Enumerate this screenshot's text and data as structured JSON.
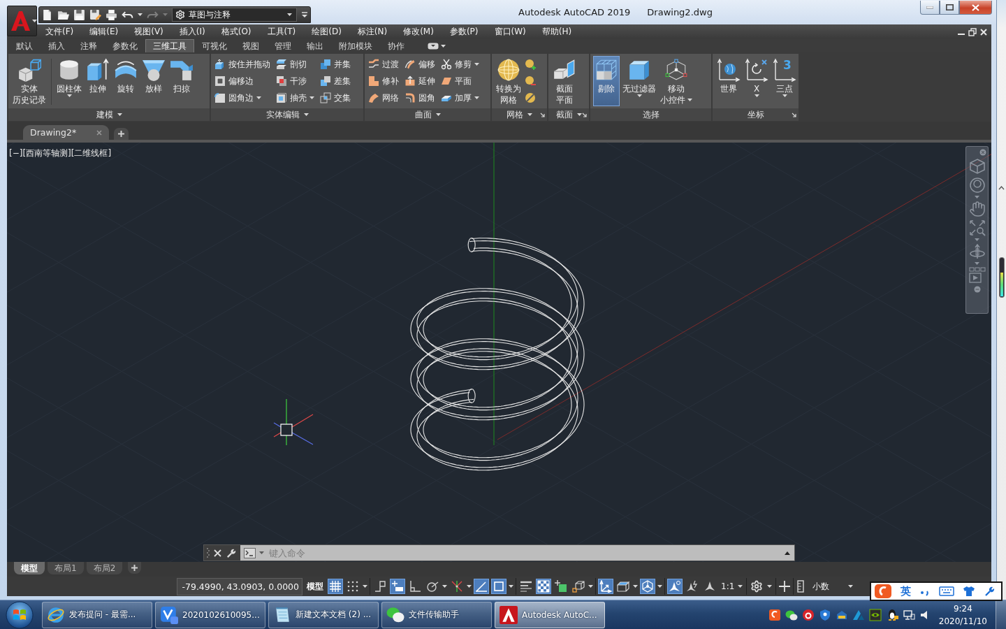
{
  "window": {
    "title": "Autodesk AutoCAD 2019",
    "document": "Drawing2.dwg"
  },
  "quick_access": [
    {
      "disabled": false
    },
    {
      "disabled": false
    },
    {
      "disabled": false
    },
    {
      "disabled": false
    },
    {
      "disabled": false
    },
    {
      "disabled": false,
      "dropdown": true
    },
    {
      "disabled": true,
      "dropdown": true
    }
  ],
  "workspace": {
    "value": "草图与注释"
  },
  "menu_bar": [
    "文件(F)",
    "编辑(E)",
    "视图(V)",
    "插入(I)",
    "格式(O)",
    "工具(T)",
    "绘图(D)",
    "标注(N)",
    "修改(M)",
    "参数(P)",
    "窗口(W)",
    "帮助(H)"
  ],
  "ribbon_tabs": [
    {
      "label": "默认",
      "selected": false
    },
    {
      "label": "插入",
      "selected": false
    },
    {
      "label": "注释",
      "selected": false
    },
    {
      "label": "参数化",
      "selected": false
    },
    {
      "label": "三维工具",
      "selected": true
    },
    {
      "label": "可视化",
      "selected": false
    },
    {
      "label": "视图",
      "selected": false
    },
    {
      "label": "管理",
      "selected": false
    },
    {
      "label": "输出",
      "selected": false
    },
    {
      "label": "附加模块",
      "selected": false
    },
    {
      "label": "协作",
      "selected": false
    }
  ],
  "ribbon_panels": [
    {
      "title": "建模",
      "menu": true,
      "launcher": false,
      "items": [
        {
          "kind": "large",
          "lines": [
            "实体",
            "历史记录"
          ]
        },
        {
          "kind": "large",
          "lines": [
            "圆柱体"
          ],
          "dropdown": true
        },
        {
          "kind": "large",
          "lines": [
            "拉伸"
          ]
        },
        {
          "kind": "large",
          "lines": [
            "旋转"
          ]
        },
        {
          "kind": "large",
          "lines": [
            "放样"
          ]
        },
        {
          "kind": "large",
          "lines": [
            "扫掠"
          ]
        }
      ]
    },
    {
      "title": "实体编辑",
      "menu": true,
      "launcher": false,
      "items": [
        {
          "kind": "small",
          "label": "按住并拖动"
        },
        {
          "kind": "small",
          "label": "偏移边"
        },
        {
          "kind": "small",
          "label": "圆角边",
          "dropdown": true
        },
        {
          "kind": "small",
          "label": "剖切"
        },
        {
          "kind": "small",
          "label": "干涉"
        },
        {
          "kind": "small",
          "label": "抽壳",
          "dropdown": true
        },
        {
          "kind": "small",
          "label": "并集"
        },
        {
          "kind": "small",
          "label": "差集"
        },
        {
          "kind": "small",
          "label": "交集"
        }
      ]
    },
    {
      "title": "曲面",
      "menu": true,
      "launcher": false,
      "items": [
        {
          "kind": "small",
          "label": "过渡"
        },
        {
          "kind": "small",
          "label": "修补"
        },
        {
          "kind": "small",
          "label": "网络"
        },
        {
          "kind": "small",
          "label": "偏移"
        },
        {
          "kind": "small",
          "label": "延伸"
        },
        {
          "kind": "small",
          "label": "圆角"
        },
        {
          "kind": "small",
          "label": "修剪",
          "dropdown": true
        },
        {
          "kind": "small",
          "label": "平面"
        },
        {
          "kind": "small",
          "label": "加厚",
          "dropdown": true
        }
      ]
    },
    {
      "title": "网格",
      "menu": true,
      "launcher": true,
      "items": [
        {
          "kind": "large",
          "lines": [
            "转换为",
            "网格"
          ]
        },
        {
          "kind": "icon"
        },
        {
          "kind": "icon"
        },
        {
          "kind": "icon"
        }
      ]
    },
    {
      "title": "截面",
      "menu": true,
      "launcher": true,
      "items": [
        {
          "kind": "large",
          "lines": [
            "截面",
            "平面"
          ]
        }
      ]
    },
    {
      "title": "选择",
      "menu": false,
      "launcher": false,
      "items": [
        {
          "kind": "large",
          "lines": [
            "剔除"
          ],
          "active": true
        },
        {
          "kind": "large",
          "lines": [
            "无过滤器"
          ],
          "dropdown": true,
          "active": false
        },
        {
          "kind": "large",
          "lines": [
            "移动",
            "小控件"
          ],
          "dropdown": true,
          "active": false
        }
      ]
    },
    {
      "title": "坐标",
      "menu": false,
      "launcher": true,
      "items": [
        {
          "kind": "large",
          "lines": [
            "世界"
          ]
        },
        {
          "kind": "large",
          "lines": [
            "X"
          ],
          "dropdown": true
        },
        {
          "kind": "large",
          "lines": [
            "三点"
          ],
          "dropdown": true,
          "icon_text": "3"
        }
      ]
    }
  ],
  "file_tabs": [
    {
      "label": "Drawing2*",
      "selected": true
    }
  ],
  "viewport": {
    "label": "[−][西南等轴测][二维线框]"
  },
  "command_line": {
    "placeholder": "键入命令"
  },
  "layout_tabs": [
    {
      "label": "模型",
      "selected": true
    },
    {
      "label": "布局1",
      "selected": false
    },
    {
      "label": "布局2",
      "selected": false
    }
  ],
  "status_bar": {
    "coordinates": "-79.4990, 43.0903, 0.0000",
    "space": "模型",
    "toggles": [
      {
        "on": true
      },
      {
        "on": false,
        "dropdown": true
      },
      {
        "on": false
      },
      {
        "on": true
      },
      {
        "on": false
      },
      {
        "on": false,
        "dropdown": true
      },
      {
        "on": false,
        "dropdown": true
      },
      {
        "on": true
      },
      {
        "on": true,
        "dropdown": true
      },
      {
        "on": false
      },
      {
        "on": true
      },
      {
        "on": false
      },
      {
        "on": false,
        "dropdown": true
      },
      {
        "on": true
      },
      {
        "on": false,
        "dropdown": true
      },
      {
        "on": true,
        "dropdown": true
      },
      {
        "on": true
      },
      {
        "on": false
      },
      {
        "on": false
      }
    ],
    "scale": "1:1",
    "units": "小数"
  },
  "ime": {
    "mode": "英"
  },
  "taskbar": {
    "buttons": [
      {
        "label": "发布提问 - 最需...",
        "selected": false
      },
      {
        "label": "2020102610095...",
        "selected": false
      },
      {
        "label": "新建文本文档 (2) ...",
        "selected": false
      },
      {
        "label": "文件传输助手",
        "selected": false
      },
      {
        "label": "Autodesk AutoC...",
        "selected": true
      }
    ],
    "time": "9:24",
    "date": "2020/11/10"
  }
}
